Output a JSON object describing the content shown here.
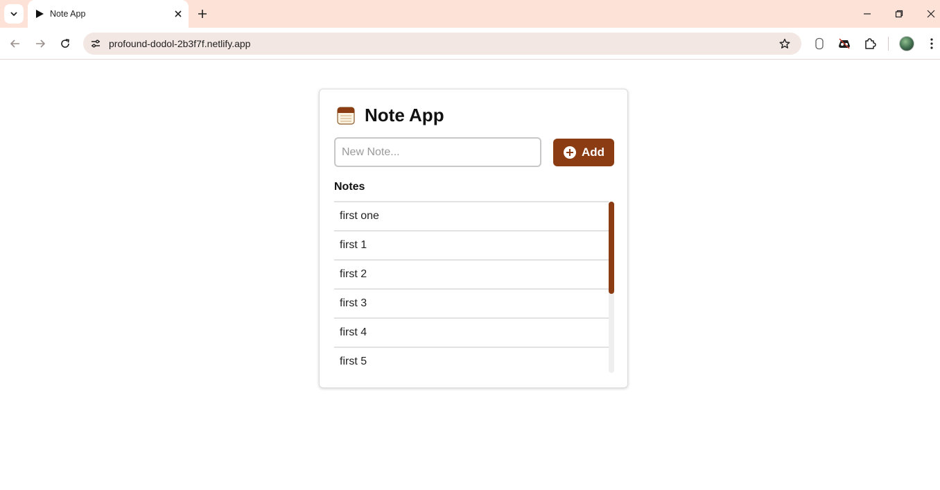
{
  "browser": {
    "tab_title": "Note App",
    "url": "profound-dodol-2b3f7f.netlify.app",
    "extension_badge": "0",
    "icons": [
      "tab-search-icon",
      "play-favicon",
      "close-icon",
      "new-tab-icon",
      "minimize-icon",
      "restore-icon",
      "window-close-icon",
      "back-icon",
      "forward-icon",
      "reload-icon",
      "site-info-icon",
      "bookmark-star-icon",
      "extension-icon",
      "puzzle-icon",
      "avatar",
      "more-menu-icon"
    ]
  },
  "app": {
    "title": "Note App",
    "icon": "notepad-icon",
    "input_placeholder": "New Note...",
    "input_value": "",
    "add_label": "Add",
    "notes_heading": "Notes",
    "notes": [
      "first one",
      "first 1",
      "first 2",
      "first 3",
      "first 4",
      "first 5"
    ],
    "accent_color": "#8b3c12"
  }
}
